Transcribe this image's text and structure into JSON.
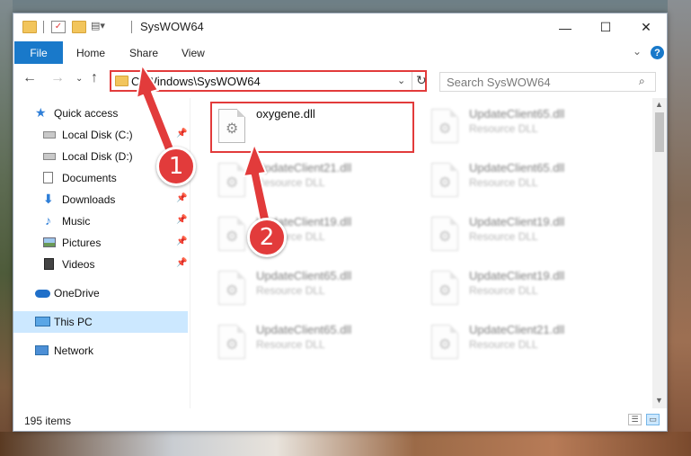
{
  "window": {
    "title": "SysWOW64",
    "minimize_glyph": "—",
    "maximize_glyph": "☐",
    "close_glyph": "✕"
  },
  "ribbon": {
    "file_tab": "File",
    "tabs": [
      "Home",
      "Share",
      "View"
    ],
    "help_glyph": "?"
  },
  "address": {
    "path": "C:\\Windows\\SysWOW64",
    "search_placeholder": "Search SysWOW64"
  },
  "nav": {
    "items": [
      {
        "label": "Quick access",
        "icon": "star-icon",
        "pinned": false
      },
      {
        "label": "Local Disk (C:)",
        "icon": "drive-icon",
        "pinned": true
      },
      {
        "label": "Local Disk (D:)",
        "icon": "drive-icon",
        "pinned": false
      },
      {
        "label": "Documents",
        "icon": "documents-icon",
        "pinned": false
      },
      {
        "label": "Downloads",
        "icon": "downloads-icon",
        "pinned": true
      },
      {
        "label": "Music",
        "icon": "music-icon",
        "pinned": true
      },
      {
        "label": "Pictures",
        "icon": "pictures-icon",
        "pinned": true
      },
      {
        "label": "Videos",
        "icon": "videos-icon",
        "pinned": true
      },
      {
        "label": "OneDrive",
        "icon": "onedrive-icon",
        "pinned": false
      },
      {
        "label": "This PC",
        "icon": "pc-icon",
        "pinned": false,
        "selected": true
      },
      {
        "label": "Network",
        "icon": "network-icon",
        "pinned": false
      }
    ]
  },
  "files": [
    {
      "name": "oxygene.dll",
      "type": "",
      "highlighted": true
    },
    {
      "name": "UpdateClient65.dll",
      "type": "Resource DLL"
    },
    {
      "name": "UpdateClient21.dll",
      "type": "Resource DLL"
    },
    {
      "name": "UpdateClient65.dll",
      "type": "Resource DLL"
    },
    {
      "name": "UpdateClient19.dll",
      "type": "Resource DLL"
    },
    {
      "name": "UpdateClient19.dll",
      "type": "Resource DLL"
    },
    {
      "name": "UpdateClient65.dll",
      "type": "Resource DLL"
    },
    {
      "name": "UpdateClient19.dll",
      "type": "Resource DLL"
    },
    {
      "name": "UpdateClient65.dll",
      "type": "Resource DLL"
    },
    {
      "name": "UpdateClient21.dll",
      "type": "Resource DLL"
    }
  ],
  "status": {
    "item_count": "195 items"
  },
  "annotations": {
    "step1": "1",
    "step2": "2",
    "color": "#e23b3b"
  }
}
